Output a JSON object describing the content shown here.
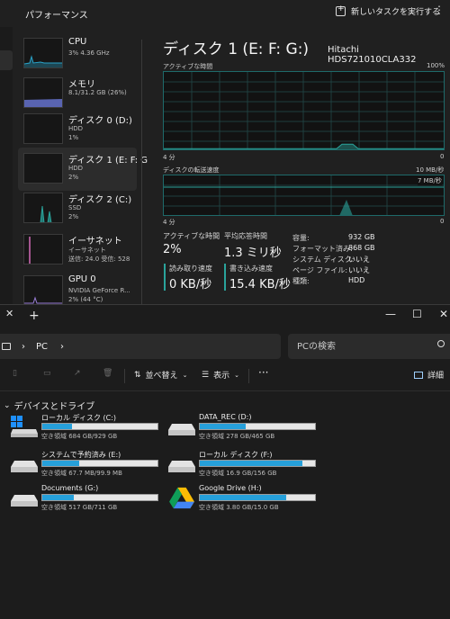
{
  "task_manager": {
    "title": "パフォーマンス",
    "run_new_task": "新しいタスクを実行する",
    "more_icon": "ellipsis-icon",
    "items": [
      {
        "name": "CPU",
        "line1": "3%  4.36 GHz",
        "line2": ""
      },
      {
        "name": "メモリ",
        "line1": "8.1/31.2 GB (26%)",
        "line2": ""
      },
      {
        "name": "ディスク 0 (D:)",
        "line1": "HDD",
        "line2": "1%"
      },
      {
        "name": "ディスク 1 (E: F: G",
        "line1": "HDD",
        "line2": "2%"
      },
      {
        "name": "ディスク 2 (C:)",
        "line1": "SSD",
        "line2": "2%"
      },
      {
        "name": "イーサネット",
        "line1": "イーサネット",
        "line2": "送信: 24.0  受信: 528"
      },
      {
        "name": "GPU 0",
        "line1": "NVIDIA GeForce R...",
        "line2": "2% (44 °C)"
      }
    ],
    "detail": {
      "title": "ディスク 1 (E: F: G:)",
      "model": "Hitachi HDS721010CLA332",
      "graph1": {
        "label": "アクティブな時間",
        "max": "100%",
        "time": "4 分",
        "min": "0",
        "activity": 2
      },
      "graph2": {
        "label": "ディスクの転送速度",
        "max": "10 MB/秒",
        "ref": "7 MB/秒",
        "time": "4 分",
        "min": "0"
      },
      "active_time_label": "アクティブな時間",
      "active_time": "2%",
      "avg_response_label": "平均応答時間",
      "avg_response": "1.3 ミリ秒",
      "read_label": "読み取り速度",
      "read": "0 KB/秒",
      "write_label": "書き込み速度",
      "write": "15.4 KB/秒",
      "props": [
        {
          "k": "容量:",
          "v": "932 GB"
        },
        {
          "k": "フォーマット済み:",
          "v": "868 GB"
        },
        {
          "k": "システム ディスク:",
          "v": "いいえ"
        },
        {
          "k": "ページ ファイル:",
          "v": "いいえ"
        },
        {
          "k": "種類:",
          "v": "HDD"
        }
      ]
    }
  },
  "explorer": {
    "new_tab": "+",
    "address": {
      "path": "PC",
      "pc_icon": "monitor-icon"
    },
    "search_placeholder": "PCの検索",
    "toolbar": {
      "sort": "並べ替え",
      "view": "表示",
      "details": "詳細"
    },
    "group": "デバイスとドライブ",
    "drives": [
      {
        "name": "ローカル ディスク (C:)",
        "free": "空き領域 684 GB/929 GB",
        "used": 0.26,
        "icon": "windows-drive-icon"
      },
      {
        "name": "DATA_REC (D:)",
        "free": "空き領域 278 GB/465 GB",
        "used": 0.4,
        "icon": "hard-drive-icon"
      },
      {
        "name": "システムで予約済み (E:)",
        "free": "空き領域 67.7 MB/99.9 MB",
        "used": 0.32,
        "icon": "hard-drive-icon"
      },
      {
        "name": "ローカル ディスク (F:)",
        "free": "空き領域 16.9 GB/156 GB",
        "used": 0.89,
        "icon": "hard-drive-icon"
      },
      {
        "name": "Documents (G:)",
        "free": "空き領域 517 GB/711 GB",
        "used": 0.27,
        "icon": "hard-drive-icon"
      },
      {
        "name": "Google Drive (H:)",
        "free": "空き領域 3.80 GB/15.0 GB",
        "used": 0.75,
        "icon": "google-drive-icon"
      }
    ]
  },
  "colors": {
    "accent": "#2aa39b",
    "cpu": "#2aa3c8",
    "memory": "#6a78d8",
    "network": "#d36ab8",
    "gpu": "#9a7ed8",
    "drive_bar": "#26a0da"
  }
}
